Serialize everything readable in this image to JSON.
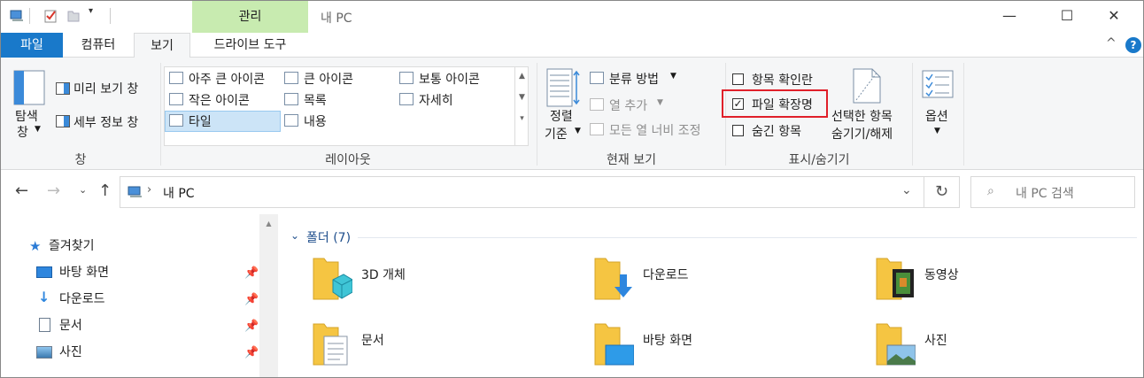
{
  "titlebar": {
    "context_tab": "관리",
    "title": "내 PC"
  },
  "tabs": {
    "file": "파일",
    "computer": "컴퓨터",
    "view": "보기",
    "drive_tools": "드라이브 도구"
  },
  "ribbon": {
    "panes": {
      "nav_pane_line1": "탐색",
      "nav_pane_line2": "창",
      "preview_pane": "미리 보기 창",
      "details_pane": "세부 정보 창",
      "group_label": "창"
    },
    "layout": {
      "extra_large_icons": "아주 큰 아이콘",
      "large_icons": "큰 아이콘",
      "medium_icons": "보통 아이콘",
      "small_icons": "작은 아이콘",
      "list": "목록",
      "details": "자세히",
      "tiles": "타일",
      "content": "내용",
      "group_label": "레이아웃"
    },
    "current_view": {
      "sort_line1": "정렬",
      "sort_line2": "기준",
      "group_by": "분류 방법",
      "add_columns": "열 추가",
      "size_columns": "모든 열 너비 조정",
      "group_label": "현재 보기"
    },
    "show_hide": {
      "item_checkboxes": "항목 확인란",
      "file_extensions": "파일 확장명",
      "hidden_items": "숨긴 항목",
      "hide_selected_line1": "선택한 항목",
      "hide_selected_line2": "숨기기/해제",
      "group_label": "표시/숨기기",
      "item_checkboxes_checked": false,
      "file_extensions_checked": true,
      "hidden_items_checked": false
    },
    "options": "옵션"
  },
  "address": {
    "path": "내 PC",
    "search_placeholder": "내 PC 검색"
  },
  "nav": {
    "quick_access": "즐겨찾기",
    "items": [
      "바탕 화면",
      "다운로드",
      "문서",
      "사진"
    ]
  },
  "content": {
    "folders_header": "폴더 (7)",
    "folders": [
      "3D 개체",
      "다운로드",
      "동영상",
      "문서",
      "바탕 화면",
      "사진"
    ]
  },
  "colors": {
    "accent": "#1979ca",
    "context_tab": "#c8ebb0",
    "highlight_border": "#e0202a",
    "folder": "#f5c542"
  }
}
